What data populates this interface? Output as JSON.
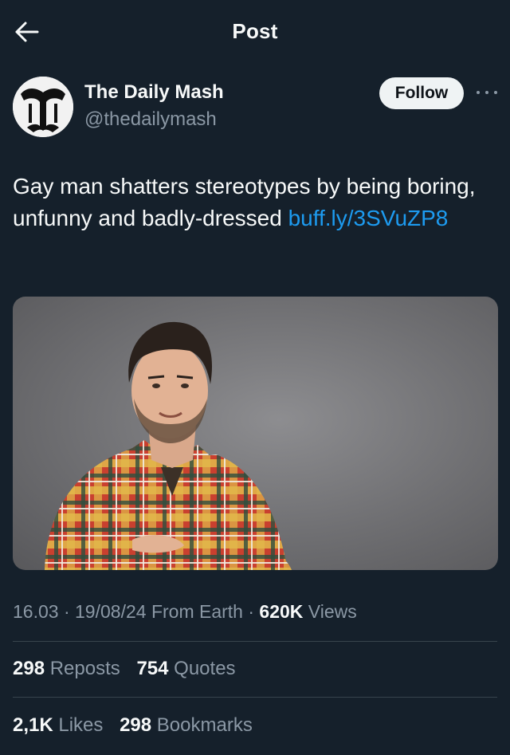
{
  "header": {
    "title": "Post",
    "back_icon": "arrow-left-icon"
  },
  "author": {
    "name": "The Daily Mash",
    "handle": "@thedailymash",
    "follow_label": "Follow",
    "avatar_icon": "newspaper-logo-icon",
    "more_icon": "more-horizontal-icon"
  },
  "tweet": {
    "text": "Gay man shatters stereotypes by being boring, unfunny and badly-dressed ",
    "link": "buff.ly/3SVuZP8"
  },
  "meta": {
    "time": "16.03",
    "sep1": " · ",
    "date": "19/08/24",
    "source": "From Earth",
    "sep2": " · ",
    "views_count": "620K",
    "views_label": "Views"
  },
  "stats": {
    "reposts_count": "298",
    "reposts_label": "Reposts",
    "quotes_count": "754",
    "quotes_label": "Quotes",
    "likes_count": "2,1K",
    "likes_label": "Likes",
    "bookmarks_count": "298",
    "bookmarks_label": "Bookmarks"
  },
  "colors": {
    "background": "#15202b",
    "accent_link": "#1d9bf0",
    "secondary_text": "#8b98a5",
    "divider": "#38444d"
  }
}
